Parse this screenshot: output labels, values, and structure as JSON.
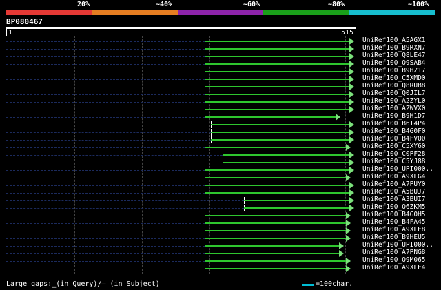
{
  "identity_scale": {
    "labels": [
      "20%",
      "~40%",
      "~60%",
      "~80%",
      "~100%"
    ],
    "colors": [
      "#e53935",
      "#e67e22",
      "#8e24aa",
      "#1aa01a",
      "#17becf"
    ]
  },
  "query": {
    "name": "BP080467",
    "start": "1",
    "end": "515"
  },
  "hits": [
    {
      "id": "UniRef100_A5AGX1",
      "q_start": 0.566,
      "q_end": 0.98
    },
    {
      "id": "UniRef100_B9RXN7",
      "q_start": 0.566,
      "q_end": 0.98
    },
    {
      "id": "UniRef100_Q8LE47",
      "q_start": 0.566,
      "q_end": 0.98
    },
    {
      "id": "UniRef100_Q9SAB4",
      "q_start": 0.566,
      "q_end": 0.98
    },
    {
      "id": "UniRef100_B9HZ17",
      "q_start": 0.566,
      "q_end": 0.98
    },
    {
      "id": "UniRef100_C5XMD0",
      "q_start": 0.566,
      "q_end": 0.98
    },
    {
      "id": "UniRef100_Q8RUB8",
      "q_start": 0.566,
      "q_end": 0.98
    },
    {
      "id": "UniRef100_Q0JIL7",
      "q_start": 0.566,
      "q_end": 0.98
    },
    {
      "id": "UniRef100_A2ZYL0",
      "q_start": 0.566,
      "q_end": 0.98
    },
    {
      "id": "UniRef100_A2WVX0",
      "q_start": 0.566,
      "q_end": 0.98
    },
    {
      "id": "UniRef100_B9H1D7",
      "q_start": 0.566,
      "q_end": 0.94
    },
    {
      "id": "UniRef100_B6T4P4",
      "q_start": 0.585,
      "q_end": 0.98
    },
    {
      "id": "UniRef100_B4G0F0",
      "q_start": 0.585,
      "q_end": 0.98
    },
    {
      "id": "UniRef100_B4FVQ0",
      "q_start": 0.585,
      "q_end": 0.98
    },
    {
      "id": "UniRef100_C5XY60",
      "q_start": 0.566,
      "q_end": 0.97
    },
    {
      "id": "UniRef100_C0PF28",
      "q_start": 0.618,
      "q_end": 0.98
    },
    {
      "id": "UniRef100_C5YJ88",
      "q_start": 0.618,
      "q_end": 0.98
    },
    {
      "id": "UniRef100_UPI000..",
      "q_start": 0.566,
      "q_end": 0.98
    },
    {
      "id": "UniRef100_A9XLG4",
      "q_start": 0.566,
      "q_end": 0.97
    },
    {
      "id": "UniRef100_A7PUY0",
      "q_start": 0.566,
      "q_end": 0.98
    },
    {
      "id": "UniRef100_A5BUJ7",
      "q_start": 0.566,
      "q_end": 0.98
    },
    {
      "id": "UniRef100_A3BUI7",
      "q_start": 0.679,
      "q_end": 0.98
    },
    {
      "id": "UniRef100_Q6ZKM5",
      "q_start": 0.679,
      "q_end": 0.98
    },
    {
      "id": "UniRef100_B4G0H5",
      "q_start": 0.566,
      "q_end": 0.97
    },
    {
      "id": "UniRef100_B4FA45",
      "q_start": 0.566,
      "q_end": 0.97
    },
    {
      "id": "UniRef100_A9XLE8",
      "q_start": 0.566,
      "q_end": 0.97
    },
    {
      "id": "UniRef100_B9HEU5",
      "q_start": 0.566,
      "q_end": 0.97
    },
    {
      "id": "UniRef100_UPI000..",
      "q_start": 0.566,
      "q_end": 0.95
    },
    {
      "id": "UniRef100_A7PNG8",
      "q_start": 0.566,
      "q_end": 0.95
    },
    {
      "id": "UniRef100_Q9M065",
      "q_start": 0.566,
      "q_end": 0.97
    },
    {
      "id": "UniRef100_A9XLE4",
      "q_start": 0.566,
      "q_end": 0.97
    }
  ],
  "legend": {
    "gaps_text": "Large gaps:▁(in Query)/— (in Subject)",
    "scale_text": "=100char."
  }
}
